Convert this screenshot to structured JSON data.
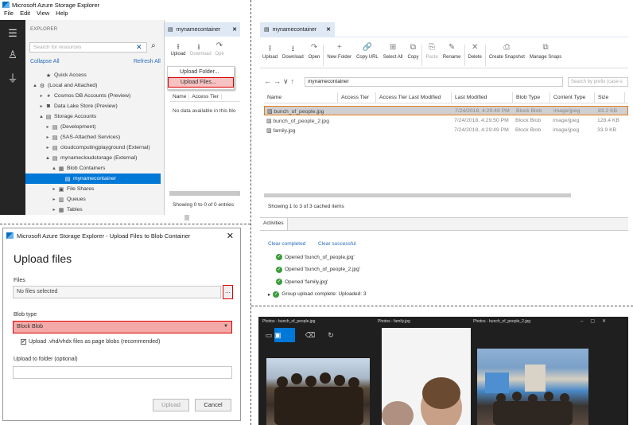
{
  "panel1": {
    "app_title": "Microsoft Azure Storage Explorer",
    "menu": [
      "File",
      "Edit",
      "View",
      "Help"
    ],
    "explorer_header": "EXPLORER",
    "search_placeholder": "Search for resources",
    "collapse_all": "Collapse All",
    "refresh_all": "Refresh All",
    "tree": [
      {
        "label": "Quick Access",
        "icon": "star-icon",
        "indent": 2,
        "arrow": ""
      },
      {
        "label": "(Local and Attached)",
        "icon": "plug-icon",
        "indent": 1,
        "arrow": "▲"
      },
      {
        "label": "Cosmos DB Accounts (Preview)",
        "icon": "planet-icon",
        "indent": 2,
        "arrow": "▸"
      },
      {
        "label": "Data Lake Store (Preview)",
        "icon": "lake-icon",
        "indent": 2,
        "arrow": "▸"
      },
      {
        "label": "Storage Accounts",
        "icon": "storage-icon",
        "indent": 2,
        "arrow": "▲"
      },
      {
        "label": "(Development)",
        "icon": "storage-icon",
        "indent": 3,
        "arrow": "▸"
      },
      {
        "label": "(SAS-Attached Services)",
        "icon": "storage-icon",
        "indent": 3,
        "arrow": "▸"
      },
      {
        "label": "cloudcomputingplayground (External)",
        "icon": "storage-icon",
        "indent": 3,
        "arrow": "▸"
      },
      {
        "label": "mynamecloudstorage (External)",
        "icon": "storage-icon",
        "indent": 3,
        "arrow": "▲"
      },
      {
        "label": "Blob Containers",
        "icon": "blob-icon",
        "indent": 4,
        "arrow": "▲"
      },
      {
        "label": "mynamecontainer",
        "icon": "container-icon",
        "indent": 5,
        "arrow": "",
        "selected": true
      },
      {
        "label": "File Shares",
        "icon": "share-icon",
        "indent": 4,
        "arrow": "▸"
      },
      {
        "label": "Queues",
        "icon": "queue-icon",
        "indent": 4,
        "arrow": "▸"
      },
      {
        "label": "Tables",
        "icon": "table-icon",
        "indent": 4,
        "arrow": "▸"
      }
    ],
    "tab_label": "mynamecontainer",
    "toolbar": {
      "upload": "Upload",
      "download": "Download",
      "open": "Ope"
    },
    "menu_items": {
      "upload_folder": "Upload Folder...",
      "upload_files": "Upload Files..."
    },
    "columns": [
      "Name",
      "Access Tier"
    ],
    "no_data": "No data available in this blo",
    "showing": "Showing 0 to 0 of 0 entries"
  },
  "panel2": {
    "dialog_title": "Microsoft Azure Storage Explorer - Upload Files to Blob Container",
    "heading": "Upload files",
    "files_label": "Files",
    "files_value": "No files selected",
    "browse_label": "...",
    "blob_type_label": "Blob type",
    "blob_type_value": "Block Blob",
    "checkbox_label": "Upload .vhd/vhdx files as page blobs (recommended)",
    "folder_label": "Upload to folder (optional)",
    "folder_value": "",
    "upload_button": "Upload",
    "cancel_button": "Cancel"
  },
  "panel3": {
    "tab_label": "mynamecontainer",
    "ribbon": [
      {
        "label": "Upload",
        "icon": "upload-icon"
      },
      {
        "label": "Download",
        "icon": "download-icon"
      },
      {
        "label": "Open",
        "icon": "open-icon"
      },
      {
        "label": "New Folder",
        "icon": "plus-icon"
      },
      {
        "label": "Copy URL",
        "icon": "link-icon"
      },
      {
        "label": "Select All",
        "icon": "select-all-icon"
      },
      {
        "label": "Copy",
        "icon": "copy-icon"
      },
      {
        "label": "Paste",
        "icon": "paste-icon"
      },
      {
        "label": "Rename",
        "icon": "rename-icon"
      },
      {
        "label": "Delete",
        "icon": "delete-icon"
      },
      {
        "label": "Create Snapshot",
        "icon": "camera-icon"
      },
      {
        "label": "Manage Snaps",
        "icon": "snapshots-icon"
      }
    ],
    "path": "mynamecontainer",
    "search_placeholder": "Search by prefix (case-s",
    "columns": [
      "Name",
      "Access Tier",
      "Access Tier Last Modified",
      "Last Modified",
      "Blob Type",
      "Content Type",
      "Size"
    ],
    "rows": [
      {
        "name": "bunch_of_people.jpg",
        "access_tier": "",
        "tier_mod": "",
        "modified": "7/24/2018, 4:29:49 PM",
        "blob_type": "Block Blob",
        "content_type": "image/jpeg",
        "size": "83.2 KB",
        "selected": true
      },
      {
        "name": "bunch_of_people_2.jpg",
        "access_tier": "",
        "tier_mod": "",
        "modified": "7/24/2018, 4:29:50 PM",
        "blob_type": "Block Blob",
        "content_type": "image/jpeg",
        "size": "128.4 KB"
      },
      {
        "name": "family.jpg",
        "access_tier": "",
        "tier_mod": "",
        "modified": "7/24/2018, 4:29:49 PM",
        "blob_type": "Block Blob",
        "content_type": "image/jpeg",
        "size": "33.9 KB"
      }
    ],
    "showing": "Showing 1 to 3 of 3 cached items",
    "activities_tab": "Activities",
    "clear_completed": "Clear completed",
    "clear_successful": "Clear successful",
    "activities": [
      "Opened 'bunch_of_people.jpg'",
      "Opened 'bunch_of_people_2.jpg'",
      "Opened 'family.jpg'",
      "Group upload complete: Uploaded: 3"
    ]
  },
  "panel4": {
    "window_titles": [
      "Photos - bunch_of_people.jpg",
      "Photos - family.jpg",
      "Photos - bunch_of_people_2.jpg"
    ]
  }
}
